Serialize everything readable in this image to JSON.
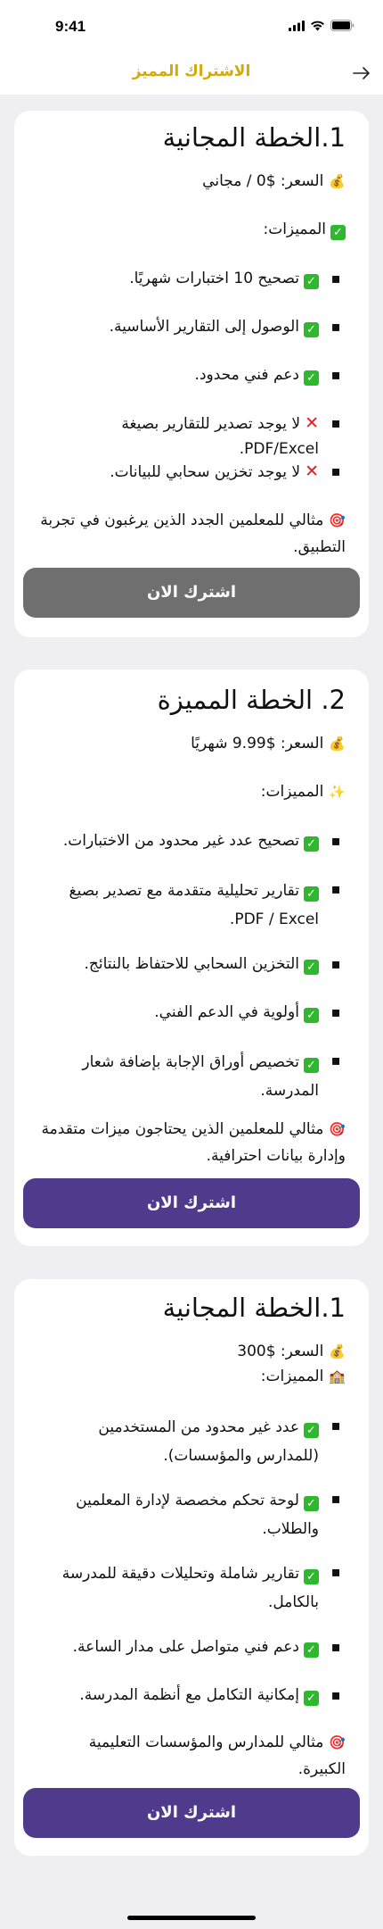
{
  "status": {
    "time": "9:41"
  },
  "nav": {
    "title": "الاشتراك المميز"
  },
  "colors": {
    "accent": "#d4a90c",
    "primary_button": "#4f3a8c",
    "disabled_button": "#6f6f6f",
    "check": "#2eb82e",
    "cross": "#e11d1d"
  },
  "plans": [
    {
      "title": "1.الخطة المجانية",
      "price": "السعر: $0 / مجاني",
      "price_icon": "money-bag-icon",
      "features_label": "المميزات:",
      "features": [
        {
          "icon": "check",
          "text": "تصحيح 10 اختبارات شهريًا."
        },
        {
          "icon": "check",
          "text": "الوصول إلى التقارير الأساسية."
        },
        {
          "icon": "check",
          "text": "دعم فني محدود."
        },
        {
          "icon": "cross",
          "text": "لا يوجد تصدير للتقارير بصيغة PDF/Excel."
        },
        {
          "icon": "cross",
          "text": "لا يوجد تخزين سحابي للبيانات."
        }
      ],
      "ideal_line1": "مثالي للمعلمين الجدد الذين يرغبون في تجربة",
      "ideal_line2": "التطبيق.",
      "button": "اشترك الان"
    },
    {
      "title": "2. الخطة المميزة",
      "price": "السعر: $9.99 شهريًا",
      "price_icon": "money-bag-icon",
      "features_label": "المميزات:",
      "features": [
        {
          "icon": "check",
          "text": "تصحيح عدد غير محدود من الاختبارات."
        },
        {
          "icon": "check",
          "text": "تقارير تحليلية متقدمة مع تصدير بصيغ",
          "text2": "PDF / Excel."
        },
        {
          "icon": "check",
          "text": "التخزين السحابي للاحتفاظ بالنتائج."
        },
        {
          "icon": "check",
          "text": "أولوية في الدعم الفني."
        },
        {
          "icon": "check",
          "text": "تخصيص أوراق الإجابة بإضافة شعار",
          "text2": "المدرسة."
        }
      ],
      "ideal_line1": "مثالي للمعلمين الذين يحتاجون ميزات متقدمة",
      "ideal_line2": "وإدارة بيانات احترافية.",
      "button": "اشترك الان"
    },
    {
      "title": "1.الخطة المجانية",
      "price": "السعر: $300",
      "price_icon": "money-bag-icon",
      "features_label": "المميزات:",
      "features": [
        {
          "icon": "check",
          "text": "عدد غير محدود من المستخدمين",
          "text2": "(للمدارس والمؤسسات)."
        },
        {
          "icon": "check",
          "text": "لوحة تحكم مخصصة لإدارة المعلمين",
          "text2": "والطلاب."
        },
        {
          "icon": "check",
          "text": "تقارير شاملة وتحليلات دقيقة للمدرسة",
          "text2": "بالكامل."
        },
        {
          "icon": "check",
          "text": "دعم فني متواصل على مدار الساعة."
        },
        {
          "icon": "check",
          "text": "إمكانية التكامل مع أنظمة المدرسة."
        }
      ],
      "ideal_line1": "مثالي للمدارس والمؤسسات التعليمية",
      "ideal_line2": "الكبيرة.",
      "button": "اشترك الان"
    }
  ]
}
